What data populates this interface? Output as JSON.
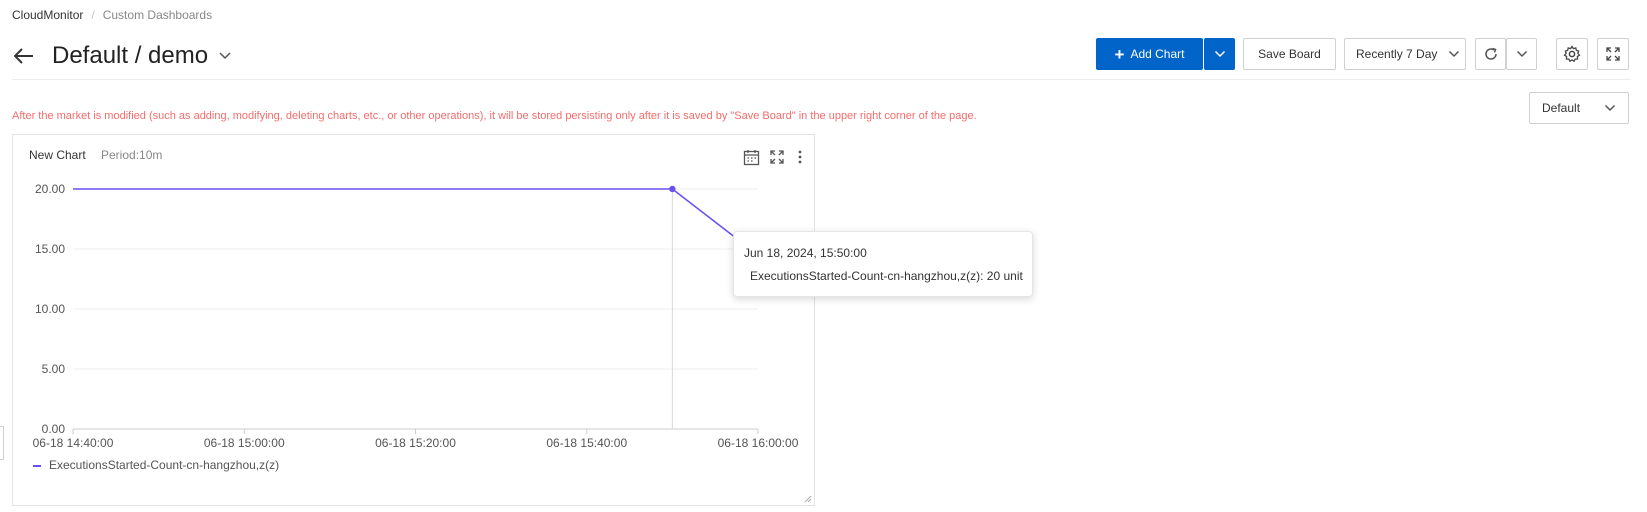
{
  "breadcrumb": {
    "root": "CloudMonitor",
    "separator": "/",
    "current": "Custom Dashboards"
  },
  "header": {
    "title": "Default / demo"
  },
  "toolbar": {
    "add_chart_label": "Add Chart",
    "save_board_label": "Save Board",
    "time_range_label": "Recently 7 Day"
  },
  "notice": "After the market is modified (such as adding, modifying, deleting charts, etc., or other operations), it will be stored persisting only after it is saved by \"Save Board\" in the upper right corner of the page.",
  "group_select": {
    "value": "Default"
  },
  "chart": {
    "title": "New Chart",
    "period": "Period:10m",
    "tooltip": {
      "time": "Jun 18, 2024, 15:50:00",
      "series": "ExecutionsStarted-Count-cn-hangzhou,z(z)",
      "value": "20 unit"
    }
  },
  "colors": {
    "primary": "#0064c8",
    "series": "#6a50f2",
    "warning": "#f26d6d"
  },
  "chart_data": {
    "type": "line",
    "title": "New Chart",
    "x_ticks": [
      "06-18 14:40:00",
      "06-18 15:00:00",
      "06-18 15:20:00",
      "06-18 15:40:00",
      "06-18 16:00:00"
    ],
    "y_ticks": [
      "0.00",
      "5.00",
      "10.00",
      "15.00",
      "20.00"
    ],
    "xlim_minutes": [
      0,
      80
    ],
    "ylim": [
      0,
      20
    ],
    "grid": true,
    "legend": "bottom-left",
    "series": [
      {
        "name": "ExecutionsStarted-Count-cn-hangzhou,z(z)",
        "color": "#6a50f2",
        "points": [
          {
            "x": 0,
            "y": 20
          },
          {
            "x": 70,
            "y": 20
          },
          {
            "x": 80,
            "y": 14.5
          }
        ],
        "highlight_x": 70
      }
    ]
  }
}
